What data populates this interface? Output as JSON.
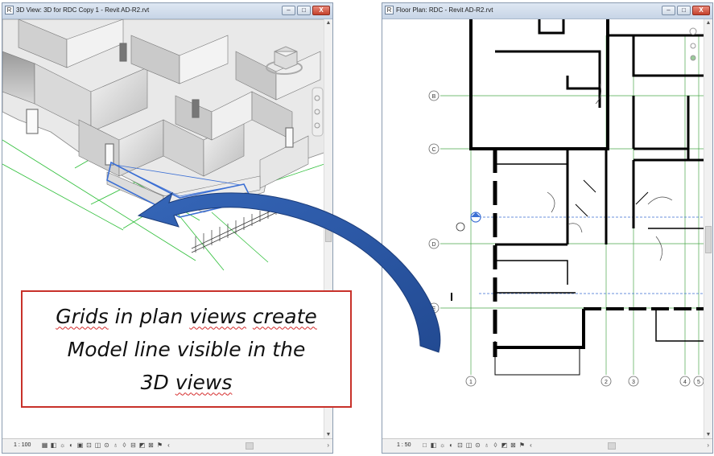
{
  "left_window": {
    "title": "3D View: 3D for RDC Copy 1 - Revit  AD-R2.rvt",
    "scale": "1 : 100"
  },
  "right_window": {
    "title": "Floor Plan: RDC - Revit  AD-R2.rvt",
    "scale": "1 : 50",
    "grid_labels_horizontal": [
      "B",
      "C",
      "D",
      "E"
    ],
    "grid_labels_vertical": [
      "1",
      "2",
      "3",
      "4",
      "5"
    ]
  },
  "window_buttons": {
    "minimize": "–",
    "maximize": "□",
    "close": "X"
  },
  "callout": {
    "lines": [
      "Grids in plan views create",
      "Model line visible in the",
      "3D views"
    ],
    "line1_parts": [
      "Grids",
      " in plan ",
      "views",
      " ",
      "create"
    ],
    "line2_parts": [
      "Model line visible in the"
    ],
    "line3_parts": [
      "3D ",
      "views"
    ]
  },
  "colors": {
    "callout_border": "#c8312a",
    "arrow": "#2a56a4",
    "grid_line_3d": "#2fbf3a",
    "grid_line_plan": "#4aa84a",
    "highlight": "#3b6fd4"
  }
}
